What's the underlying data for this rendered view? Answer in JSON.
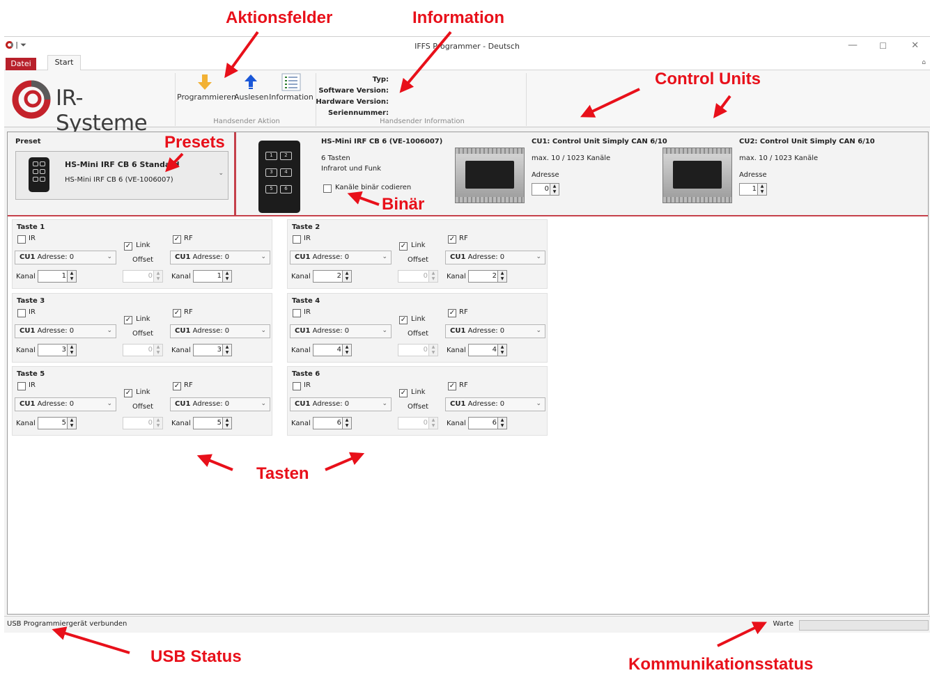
{
  "window": {
    "title": "IFFS Programmеr - Deutsch",
    "minimize": "—",
    "maximize": "☐",
    "close": "✕"
  },
  "tabs": {
    "datei": "Datei",
    "start": "Start"
  },
  "brand": {
    "name": "IR-Systeme"
  },
  "ribbon": {
    "actions": [
      {
        "label": "Programmieren",
        "icon": "download-arrow-icon"
      },
      {
        "label": "Auslesen",
        "icon": "upload-arrow-icon"
      },
      {
        "label": "Information",
        "icon": "list-icon"
      }
    ],
    "actions_group": "Handsender Aktion",
    "info_labels": [
      "Typ:",
      "Software Version:",
      "Hardware Version:",
      "Seriennummer:"
    ],
    "info_group": "Handsender Information"
  },
  "preset": {
    "header": "Preset",
    "selected_name": "HS-Mini IRF CB 6 Standard",
    "selected_model": "HS-Mini IRF CB 6 (VE-1006007)"
  },
  "device": {
    "title": "HS-Mini IRF CB 6 (VE-1006007)",
    "keys": "6 Tasten",
    "type": "Infrarot und Funk",
    "binary_label": "Kanäle binär codieren",
    "binary_checked": false
  },
  "control_units": [
    {
      "title": "CU1: Control Unit Simply CAN 6/10",
      "channels": "max. 10 / 1023 Kanäle",
      "address_label": "Adresse",
      "address": "0"
    },
    {
      "title": "CU2: Control Unit Simply CAN 6/10",
      "channels": "max. 10 / 1023 Kanäle",
      "address_label": "Adresse",
      "address": "1"
    }
  ],
  "key_labels": {
    "ir": "IR",
    "rf": "RF",
    "link": "Link",
    "offset": "Offset",
    "kanal": "Kanal",
    "cu": "CU1",
    "cu_addr": "Adresse: 0",
    "offset_value": "0"
  },
  "keys": [
    {
      "title": "Taste 1",
      "ir_checked": false,
      "rf_checked": true,
      "link_checked": true,
      "ir_channel": "1",
      "rf_channel": "1"
    },
    {
      "title": "Taste 2",
      "ir_checked": false,
      "rf_checked": true,
      "link_checked": true,
      "ir_channel": "2",
      "rf_channel": "2"
    },
    {
      "title": "Taste 3",
      "ir_checked": false,
      "rf_checked": true,
      "link_checked": true,
      "ir_channel": "3",
      "rf_channel": "3"
    },
    {
      "title": "Taste 4",
      "ir_checked": false,
      "rf_checked": true,
      "link_checked": true,
      "ir_channel": "4",
      "rf_channel": "4"
    },
    {
      "title": "Taste 5",
      "ir_checked": false,
      "rf_checked": true,
      "link_checked": true,
      "ir_channel": "5",
      "rf_channel": "5"
    },
    {
      "title": "Taste 6",
      "ir_checked": false,
      "rf_checked": true,
      "link_checked": true,
      "ir_channel": "6",
      "rf_channel": "6"
    }
  ],
  "status": {
    "usb": "USB Programmiergerät verbunden",
    "comm": "Warte"
  },
  "annotations": {
    "aktionsfelder": "Aktionsfelder",
    "information": "Information",
    "control_units": "Control Units",
    "presets": "Presets",
    "binaer": "Binär",
    "tasten": "Tasten",
    "usb_status": "USB Status",
    "kommunikation": "Kommunikationsstatus"
  },
  "colors": {
    "accent": "#b8202b",
    "annotation": "#e8101a",
    "primary_arrow": "#1a57d8",
    "action_arrow": "#f2b134"
  }
}
